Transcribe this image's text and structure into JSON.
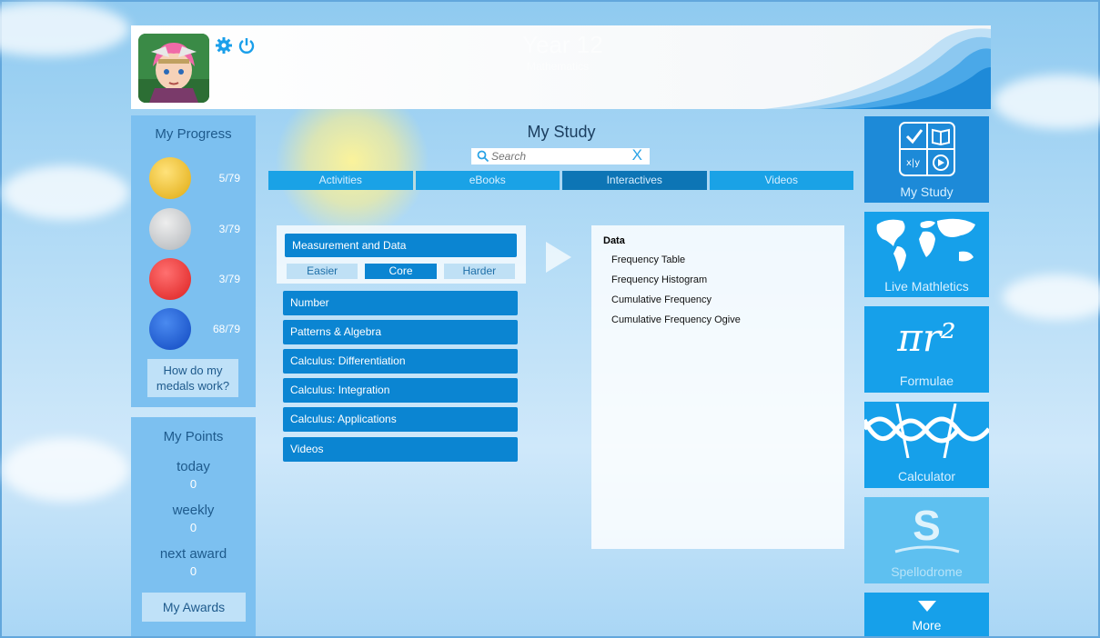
{
  "header": {
    "title": "Year 12",
    "subtitle": "Mathematics",
    "settings_icon": "gear-icon",
    "power_icon": "power-icon"
  },
  "progress": {
    "title": "My Progress",
    "medals": [
      {
        "name": "gold",
        "color": "#f2c230",
        "count": "5/79"
      },
      {
        "name": "silver",
        "color": "#c8ccd0",
        "count": "3/79"
      },
      {
        "name": "red",
        "color": "#ee3a3a",
        "count": "3/79"
      },
      {
        "name": "blue",
        "color": "#1c5ed8",
        "count": "68/79"
      }
    ],
    "help_line1": "How do my",
    "help_line2": "medals work?"
  },
  "points": {
    "title": "My Points",
    "today_label": "today",
    "today_value": "0",
    "weekly_label": "weekly",
    "weekly_value": "0",
    "next_label": "next award",
    "next_value": "0",
    "awards_button": "My Awards"
  },
  "main": {
    "title": "My Study",
    "search_placeholder": "Search",
    "clear_label": "X",
    "tabs": [
      "Activities",
      "eBooks",
      "Interactives",
      "Videos"
    ],
    "active_tab": "Interactives",
    "selected_topic": "Measurement and Data",
    "difficulty": [
      "Easier",
      "Core",
      "Harder"
    ],
    "active_difficulty": "Core",
    "topics": [
      "Number",
      "Patterns & Algebra",
      "Calculus: Differentiation",
      "Calculus: Integration",
      "Calculus: Applications",
      "Videos"
    ]
  },
  "content": {
    "heading": "Data",
    "items": [
      "Frequency Table",
      "Frequency Histogram",
      "Cumulative Frequency",
      "Cumulative Frequency Ogive"
    ]
  },
  "right_nav": {
    "my_study": "My Study",
    "live_mathletics": "Live Mathletics",
    "formulae": "Formulae",
    "formulae_symbol": "πr²",
    "calculator": "Calculator",
    "spellodrome": "Spellodrome",
    "spellodrome_letter": "S",
    "more": "More"
  },
  "colors": {
    "accent": "#16a0ea",
    "active_tab": "#0d75b5",
    "topic": "#0b85d2"
  }
}
